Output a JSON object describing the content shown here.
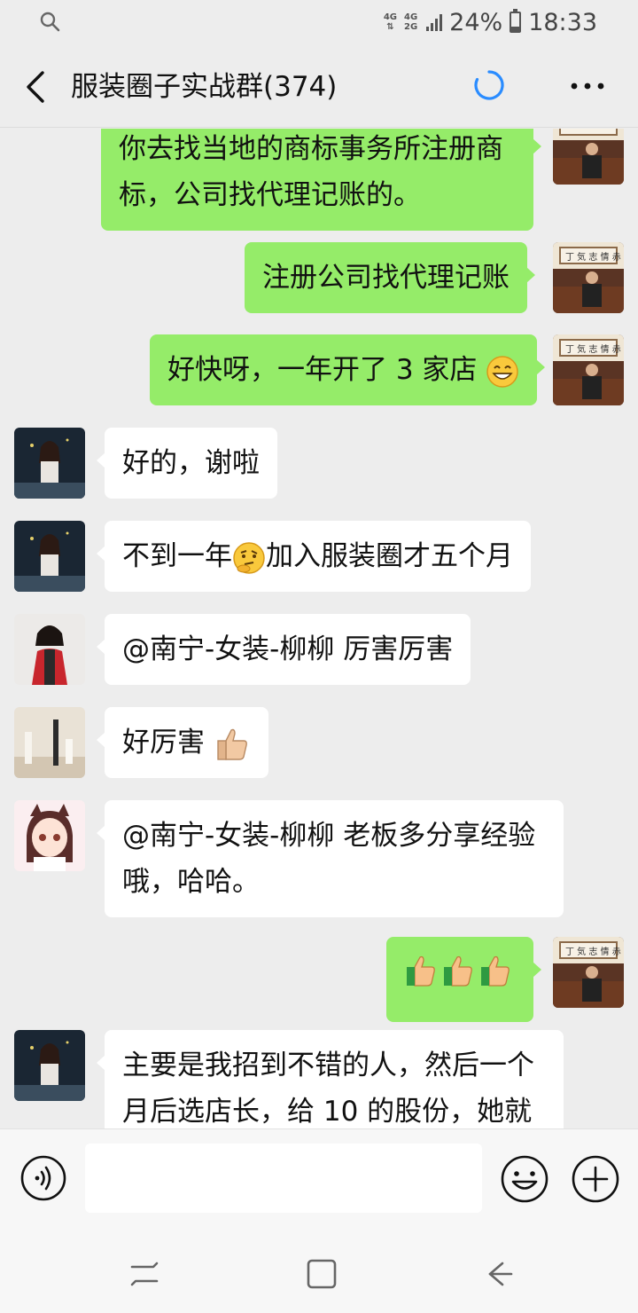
{
  "status_bar": {
    "net_a_top": "4G",
    "net_b_top": "4G",
    "net_b_bottom": "2G",
    "battery_percent": "24%",
    "battery_level": 0.24,
    "time": "18:33"
  },
  "nav": {
    "title": "服装圈子实战群(374)"
  },
  "messages": [
    {
      "side": "me",
      "lines": [
        "你去找当地的商标事务所注册商",
        "标，公司找代理记账的。"
      ]
    },
    {
      "side": "me",
      "text": "注册公司找代理记账"
    },
    {
      "side": "me",
      "text": "好快呀，一年开了 3 家店",
      "emoji": "grin-emoji"
    },
    {
      "side": "other",
      "text": "好的，谢啦"
    },
    {
      "side": "other",
      "text_before": "不到一年",
      "emoji": "thinking-emoji",
      "text_after": "加入服装圈才五个月"
    },
    {
      "side": "other",
      "text": "@南宁-女装-柳柳  厉害厉害"
    },
    {
      "side": "other",
      "text": "好厉害",
      "emoji": "thumbs-up-emoji"
    },
    {
      "side": "other",
      "lines": [
        "@南宁-女装-柳柳  老板多分享经验",
        "哦，哈哈。"
      ]
    },
    {
      "side": "me",
      "emoji": "three-thumbs-up-emoji"
    },
    {
      "side": "other",
      "lines": [
        "主要是我招到不错的人，然后一个",
        "月后选店长，给 10 的股份，她就"
      ]
    }
  ],
  "input": {
    "placeholder": "",
    "value": ""
  },
  "colors": {
    "background": "#ededed",
    "my_bubble": "#95ec69",
    "other_bubble": "#ffffff",
    "accent_loading": "#2a8cff"
  }
}
